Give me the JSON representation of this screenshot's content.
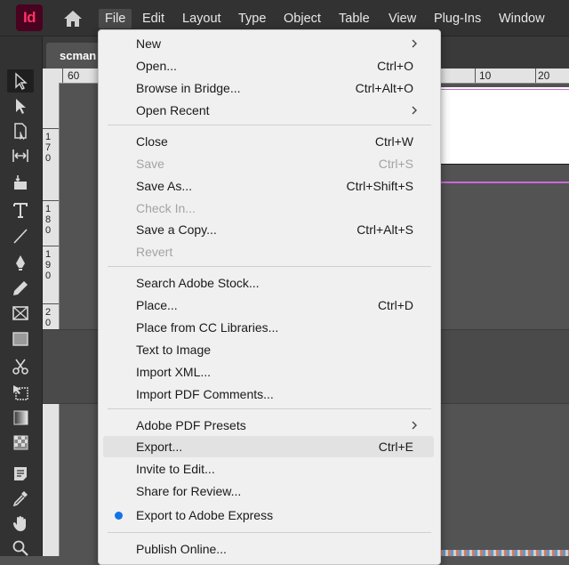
{
  "app": {
    "logo_text": "Id",
    "logo_color": "#ff3366",
    "logo_bg": "#49021f"
  },
  "menubar": {
    "items": [
      {
        "label": "File",
        "active": true
      },
      {
        "label": "Edit"
      },
      {
        "label": "Layout"
      },
      {
        "label": "Type"
      },
      {
        "label": "Object"
      },
      {
        "label": "Table"
      },
      {
        "label": "View"
      },
      {
        "label": "Plug-Ins"
      },
      {
        "label": "Window"
      }
    ]
  },
  "document": {
    "tab_label": "scman"
  },
  "ruler": {
    "top_labels": [
      "60",
      "10",
      "20"
    ],
    "left_labels": [
      "1",
      "7",
      "0",
      "1",
      "8",
      "0",
      "1",
      "9",
      "0",
      "2",
      "0"
    ]
  },
  "toolbar": {
    "collapse_glyph": "»"
  },
  "file_menu": {
    "accent_color": "#1473e6",
    "items": [
      {
        "label": "New",
        "submenu": true
      },
      {
        "label": "Open...",
        "shortcut": "Ctrl+O"
      },
      {
        "label": "Browse in Bridge...",
        "shortcut": "Ctrl+Alt+O"
      },
      {
        "label": "Open Recent",
        "submenu": true
      },
      {
        "label": "Close",
        "shortcut": "Ctrl+W"
      },
      {
        "label": "Save",
        "shortcut": "Ctrl+S",
        "disabled": true
      },
      {
        "label": "Save As...",
        "shortcut": "Ctrl+Shift+S"
      },
      {
        "label": "Check In...",
        "disabled": true
      },
      {
        "label": "Save a Copy...",
        "shortcut": "Ctrl+Alt+S"
      },
      {
        "label": "Revert",
        "disabled": true
      },
      {
        "label": "Search Adobe Stock..."
      },
      {
        "label": "Place...",
        "shortcut": "Ctrl+D"
      },
      {
        "label": "Place from CC Libraries..."
      },
      {
        "label": "Text to Image"
      },
      {
        "label": "Import XML..."
      },
      {
        "label": "Import PDF Comments..."
      },
      {
        "label": "Adobe PDF Presets",
        "submenu": true
      },
      {
        "label": "Export...",
        "shortcut": "Ctrl+E",
        "highlighted": true
      },
      {
        "label": "Invite to Edit..."
      },
      {
        "label": "Share for Review..."
      },
      {
        "label": "Export to Adobe Express",
        "badge": true
      },
      {
        "label": "Publish Online..."
      }
    ]
  }
}
